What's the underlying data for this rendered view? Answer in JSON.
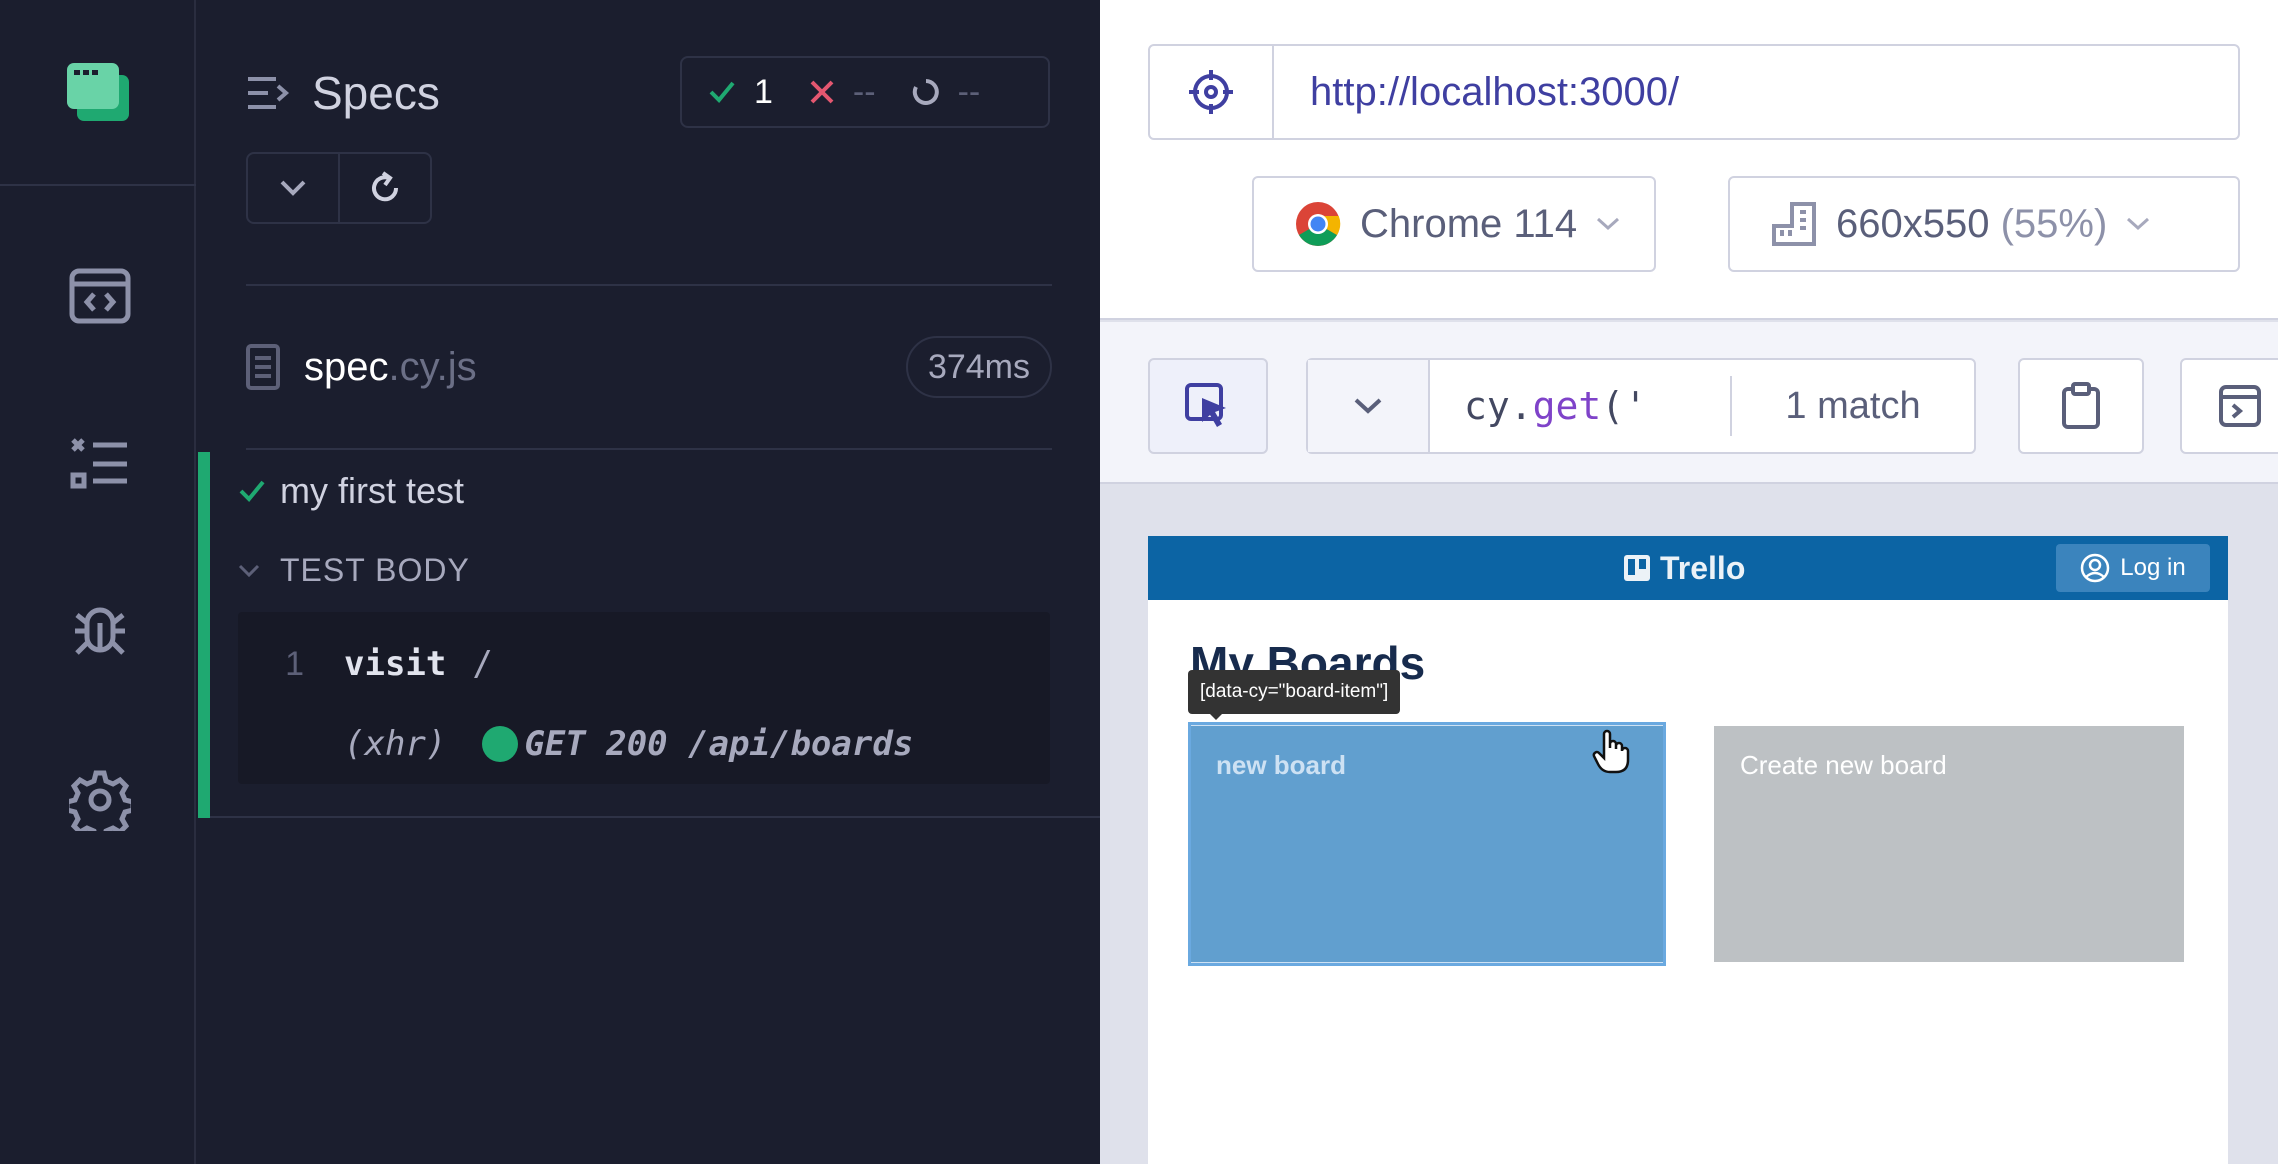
{
  "nav": {
    "items": [
      "app-logo-icon",
      "specs-icon",
      "runs-icon",
      "debug-icon",
      "settings-icon"
    ]
  },
  "reporter": {
    "specs_label": "Specs",
    "stats": {
      "passed": "1",
      "failed": "--",
      "pending": "--"
    },
    "spec": {
      "name": "spec",
      "ext": ".cy.js",
      "duration": "374ms"
    },
    "test": {
      "title": "my first test",
      "body_label": "TEST BODY",
      "commands": [
        {
          "num": "1",
          "name": "visit",
          "message": "/"
        },
        {
          "num": "",
          "name": "(xhr)",
          "message": "GET 200 /api/boards"
        }
      ]
    }
  },
  "preview": {
    "url": "http://localhost:3000/",
    "browser": {
      "name": "Chrome 114"
    },
    "viewport": {
      "size": "660x550",
      "scale": "(55%)"
    },
    "selector": {
      "method": "cy.",
      "fn": "get",
      "arg": "('",
      "matches": "1 match"
    }
  },
  "aut": {
    "logo": "Trello",
    "login": "Log in",
    "heading": "My Boards",
    "tooltip": "[data-cy=\"board-item\"]",
    "boards": [
      {
        "title": "new board",
        "color": "#5a9ac8"
      },
      {
        "title": "Create new board",
        "color": "#bdc1c4"
      }
    ]
  },
  "colors": {
    "pass": "#1fa971",
    "fail": "#e45770",
    "link": "#3f3fa1",
    "trello_header": "#0c64a4"
  }
}
